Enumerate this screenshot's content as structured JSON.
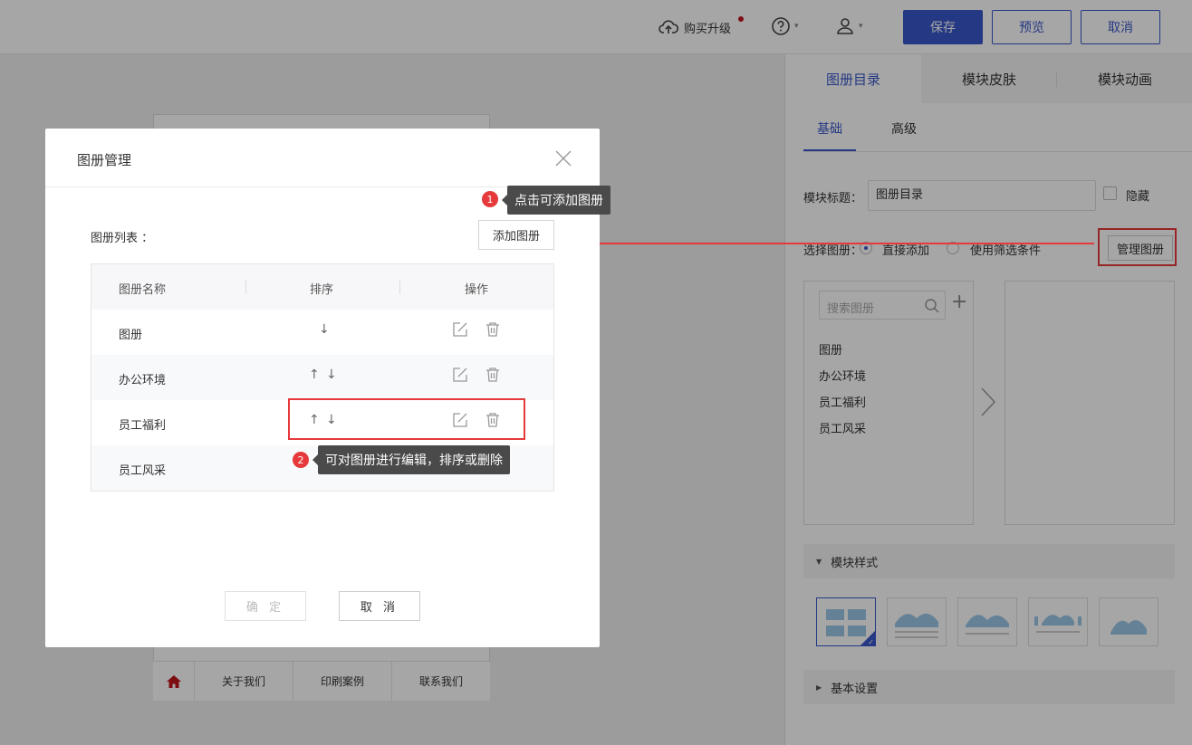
{
  "topbar": {
    "upgrade_label": "购买升级",
    "save_label": "保存",
    "preview_label": "预览",
    "cancel_label": "取消"
  },
  "phone": {
    "nav": [
      "关于我们",
      "印刷案例",
      "联系我们"
    ]
  },
  "right_panel": {
    "tabs": [
      "图册目录",
      "模块皮肤",
      "模块动画"
    ],
    "subtabs": [
      "基础",
      "高级"
    ],
    "module_title_label": "模块标题：",
    "module_title_value": "图册目录",
    "hide_label": "隐藏",
    "select_label": "选择图册：",
    "option_direct": "直接添加",
    "option_filter": "使用筛选条件",
    "manage_button": "管理图册",
    "search_placeholder": "搜索图册",
    "albums": [
      "图册",
      "办公环境",
      "员工福利",
      "员工风采"
    ],
    "section_style": "模块样式",
    "section_basic": "基本设置"
  },
  "modal": {
    "title": "图册管理",
    "list_label": "图册列表 ：",
    "add_button": "添加图册",
    "columns": [
      "图册名称",
      "排序",
      "操作"
    ],
    "rows": [
      {
        "name": "图册"
      },
      {
        "name": "办公环境"
      },
      {
        "name": "员工福利"
      },
      {
        "name": "员工风采"
      }
    ],
    "confirm_label": "确 定",
    "cancel_label": "取 消"
  },
  "tips": {
    "tip1_num": "1",
    "tip1_text": "点击可添加图册",
    "tip2_num": "2",
    "tip2_text": "可对图册进行编辑，排序或删除"
  },
  "colors": {
    "accent": "#3957c9",
    "highlight": "#e5393b",
    "tooltip": "#4a4a4a"
  }
}
